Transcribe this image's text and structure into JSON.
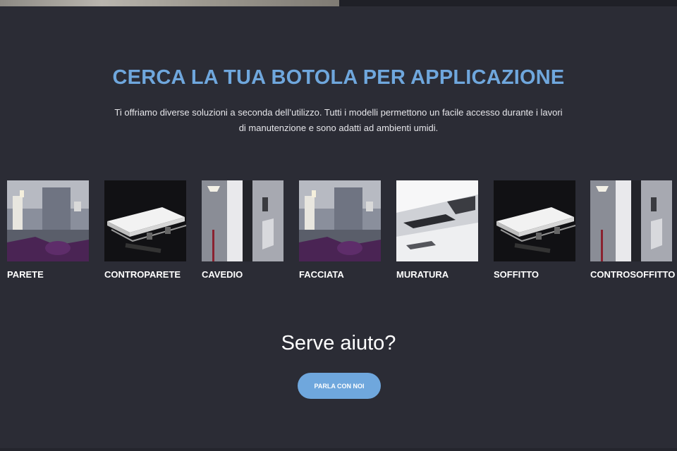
{
  "header": {
    "title": "CERCA LA TUA BOTOLA PER APPLICAZIONE",
    "description": "Ti offriamo diverse soluzioni a seconda dell’utilizzo. Tutti i modelli permettono un facile accesso durante i lavori di manutenzione e sono adatti ad ambienti umidi."
  },
  "applications": [
    {
      "label": "PARETE",
      "image": "room-interior"
    },
    {
      "label": "CONTROPARETE",
      "image": "hatch-panel"
    },
    {
      "label": "CAVEDIO",
      "image": "shaft-wall"
    },
    {
      "label": "FACCIATA",
      "image": "room-interior"
    },
    {
      "label": "MURATURA",
      "image": "ceiling-hatch"
    },
    {
      "label": "SOFFITTO",
      "image": "hatch-panel"
    },
    {
      "label": "CONTROSOFFITTO",
      "image": "shaft-wall"
    }
  ],
  "help": {
    "title": "Serve aiuto?",
    "cta_label": "PARLA CON NOI"
  },
  "colors": {
    "background": "#2b2c35",
    "accent": "#6fa7dd",
    "text": "#ffffff"
  }
}
